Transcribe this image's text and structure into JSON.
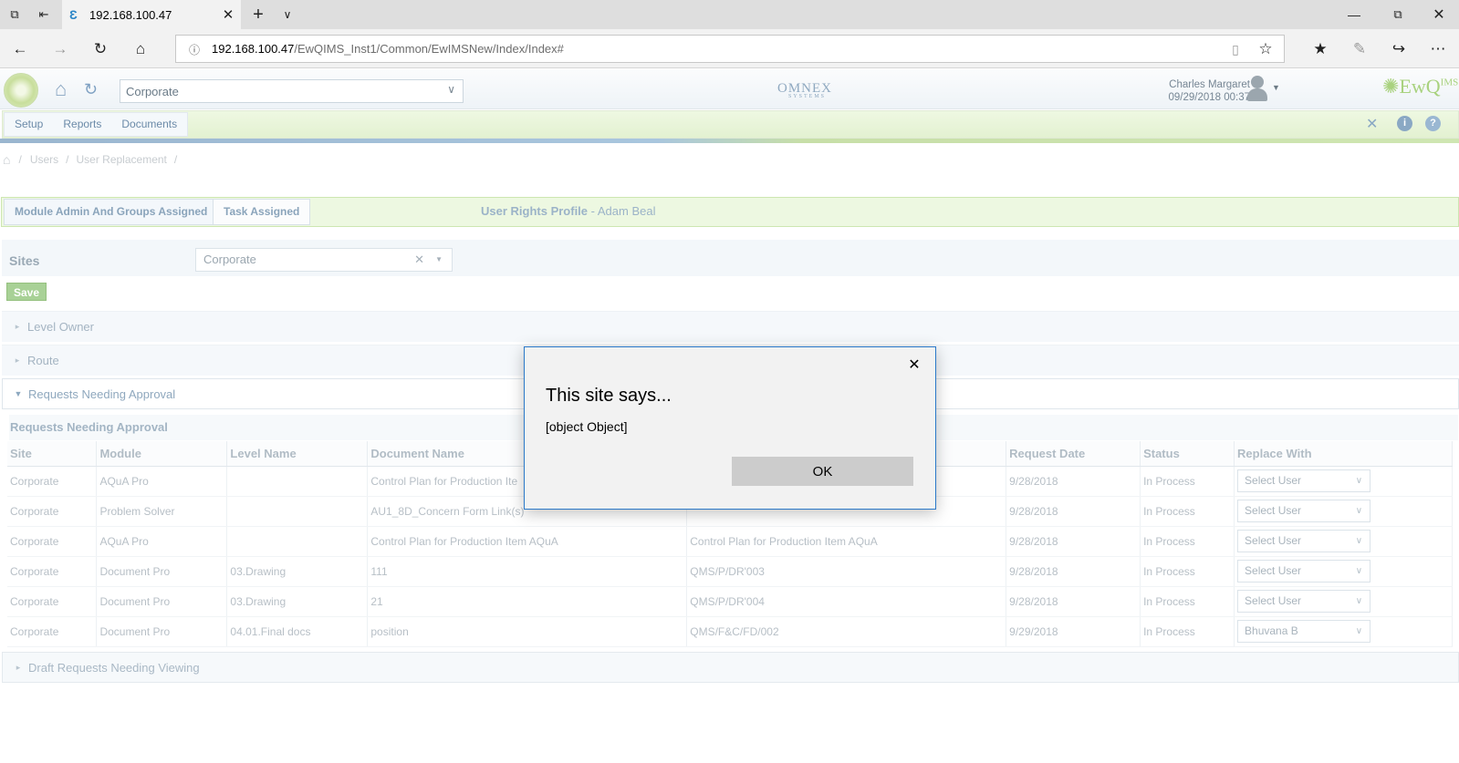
{
  "browser": {
    "tab_title": "192.168.100.47",
    "url_host": "192.168.100.47",
    "url_path": "/EwQIMS_Inst1/Common/EwIMSNew/Index/Index#"
  },
  "header": {
    "site_select": "Corporate",
    "brand_center": "OMNEX",
    "brand_center_sub": "SYSTEMS",
    "user_name": "Charles Margaret",
    "user_datetime": "09/29/2018 00:37",
    "brand_right": "EwQ",
    "brand_right_sup": "IMS"
  },
  "menu": {
    "items": [
      {
        "label": "Setup"
      },
      {
        "label": "Reports"
      },
      {
        "label": "Documents"
      }
    ]
  },
  "breadcrumb": {
    "items": [
      {
        "label": "Users"
      },
      {
        "label": "User Replacement"
      }
    ]
  },
  "tabs": {
    "items": [
      {
        "label": "Module Admin And Groups Assigned"
      },
      {
        "label": "Task Assigned"
      }
    ],
    "profile_label": "User Rights Profile",
    "profile_name": "- Adam Beal"
  },
  "sites": {
    "label": "Sites",
    "value": "Corporate"
  },
  "save_label": "Save",
  "accordion": {
    "level_owner": "Level Owner",
    "route": "Route",
    "requests": "Requests Needing Approval",
    "draft": "Draft Requests Needing Viewing"
  },
  "requests_table": {
    "title": "Requests Needing Approval",
    "columns": [
      "Site",
      "Module",
      "Level Name",
      "Document Name",
      "",
      "Request Date",
      "Status",
      "Replace With"
    ],
    "rows": [
      [
        "Corporate",
        "AQuA Pro",
        "",
        "Control Plan for Production Ite",
        "",
        "9/28/2018",
        "In Process",
        "Select User"
      ],
      [
        "Corporate",
        "Problem Solver",
        "",
        "AU1_8D_Concern Form Link(s)",
        "",
        "9/28/2018",
        "In Process",
        "Select User"
      ],
      [
        "Corporate",
        "AQuA Pro",
        "",
        "Control Plan for Production Item AQuA",
        "Control Plan for Production Item AQuA",
        "9/28/2018",
        "In Process",
        "Select User"
      ],
      [
        "Corporate",
        "Document Pro",
        "03.Drawing",
        "111",
        "QMS/P/DR'003",
        "9/28/2018",
        "In Process",
        "Select User"
      ],
      [
        "Corporate",
        "Document Pro",
        "03.Drawing",
        "21",
        "QMS/P/DR'004",
        "9/28/2018",
        "In Process",
        "Select User"
      ],
      [
        "Corporate",
        "Document Pro",
        "04.01.Final docs",
        "position",
        "QMS/F&C/FD/002",
        "9/29/2018",
        "In Process",
        "Bhuvana B"
      ]
    ]
  },
  "dialog": {
    "title": "This site says...",
    "message": "[object Object]",
    "ok_label": "OK"
  }
}
